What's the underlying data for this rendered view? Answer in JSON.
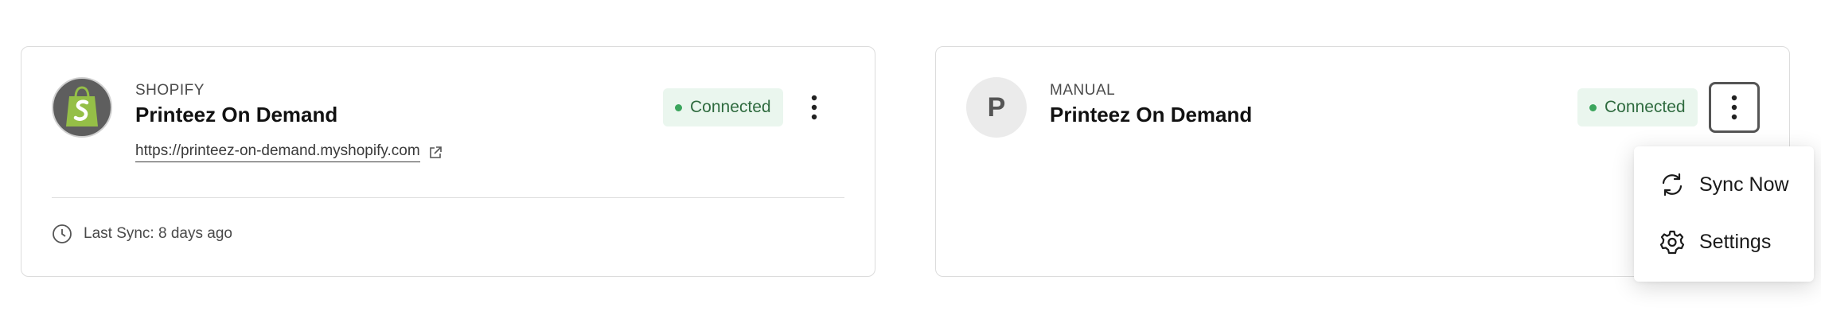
{
  "integrations": [
    {
      "platform": "SHOPIFY",
      "store_name": "Printeez On Demand",
      "store_url": "https://printeez-on-demand.myshopify.com",
      "status": "Connected",
      "last_sync": "Last Sync: 8 days ago",
      "avatar_icon": "shopify-bag-icon"
    },
    {
      "platform": "MANUAL",
      "store_name": "Printeez On Demand",
      "status": "Connected",
      "avatar_letter": "P"
    }
  ],
  "menu": {
    "items": [
      {
        "label": "Sync Now",
        "icon": "sync-icon"
      },
      {
        "label": "Settings",
        "icon": "gear-icon"
      }
    ]
  },
  "colors": {
    "status_bg": "#eaf6ee",
    "status_text": "#2f6b3f",
    "status_dot": "#3ba55c",
    "shopify_green": "#95bf47"
  }
}
